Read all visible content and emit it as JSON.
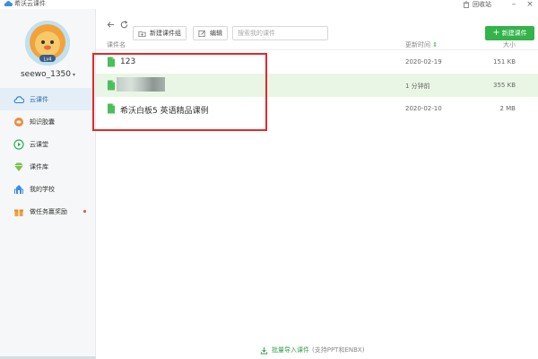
{
  "window": {
    "title": "希沃云课件",
    "recycle_label": "回收站",
    "minimize": "–",
    "close": "×"
  },
  "user": {
    "name": "seewo_1350",
    "level_badge": "Lv4"
  },
  "sidebar": {
    "items": [
      {
        "label": "云课件",
        "icon": "cloud-icon",
        "active": true
      },
      {
        "label": "知识胶囊",
        "icon": "capsule-icon",
        "active": false
      },
      {
        "label": "云课堂",
        "icon": "play-icon",
        "active": false
      },
      {
        "label": "课件库",
        "icon": "diamond-icon",
        "active": false
      },
      {
        "label": "我的学校",
        "icon": "school-icon",
        "active": false
      },
      {
        "label": "做任务赢奖励",
        "icon": "gift-icon",
        "active": false,
        "badge_dot": true
      }
    ]
  },
  "toolbar": {
    "back_icon": "back-arrow-icon",
    "refresh_icon": "refresh-icon",
    "new_group_label": "新建课件组",
    "edit_label": "编辑",
    "search_placeholder": "搜索我的课件",
    "new_courseware_label": "新建课件"
  },
  "table": {
    "headers": {
      "name": "课件名",
      "date": "更新时间",
      "date_sort": "⇕",
      "size": "大小"
    },
    "rows": [
      {
        "name": "123",
        "date": "2020-02-19",
        "size": "151 KB",
        "selected": false,
        "blurred": false
      },
      {
        "name": "",
        "date": "1 分钟前",
        "size": "355 KB",
        "selected": true,
        "blurred": true
      },
      {
        "name": "希沃白板5 英语精品课例",
        "date": "2020-02-10",
        "size": "2 MB",
        "selected": false,
        "blurred": false
      }
    ]
  },
  "footer": {
    "import_label": "批量导入课件",
    "import_note": "(支持PPT和ENBX)"
  },
  "colors": {
    "accent_green": "#33b34a",
    "highlight_red": "#e02b2b",
    "active_nav_bg": "#e4eef6"
  }
}
